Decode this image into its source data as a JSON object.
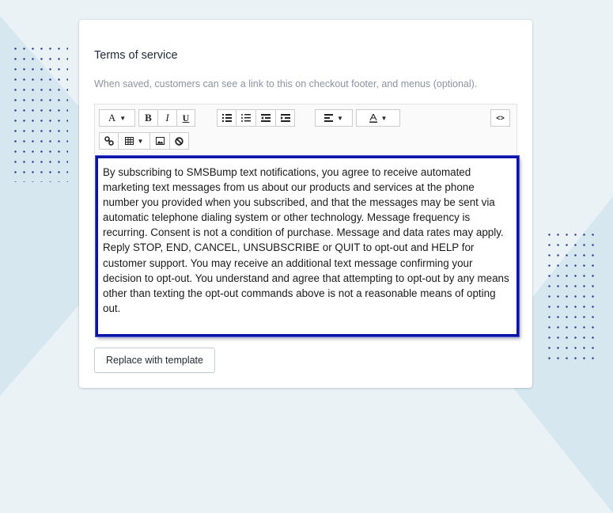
{
  "section": {
    "title": "Terms of service",
    "help_text": "When saved, customers can see a link to this on checkout footer, and menus (optional)."
  },
  "toolbar": {
    "font_size_label": "A",
    "bold_label": "B",
    "italic_label": "I",
    "underline_label": "U",
    "code_view_label": "<>"
  },
  "editor": {
    "content": "By subscribing to SMSBump text notifications, you agree to receive automated marketing text messages from us about our products and services at the phone number you provided when you subscribed, and that the messages may be sent via automatic telephone dialing system or other technology. Message frequency is recurring.  Consent is not a condition of purchase. Message and data rates may apply. Reply STOP, END, CANCEL, UNSUBSCRIBE or QUIT to opt-out and HELP for customer support. You may receive an additional text message confirming your decision to opt-out.  You understand and agree that attempting to opt-out by any means other than texting the opt-out commands above is not a reasonable means of opting out."
  },
  "actions": {
    "replace_label": "Replace with template"
  },
  "colors": {
    "editor_border": "#0a12a8",
    "background": "#eaf2f6"
  }
}
